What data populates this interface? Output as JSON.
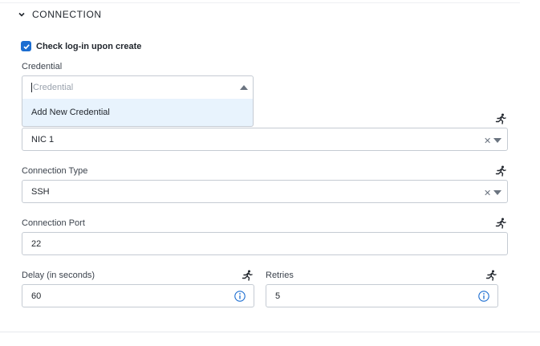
{
  "section": {
    "title": "CONNECTION"
  },
  "check_login": {
    "label": "Check log-in upon create",
    "checked": true
  },
  "credential": {
    "label": "Credential",
    "placeholder": "Credential",
    "options": [
      "Add New Credential"
    ]
  },
  "nic": {
    "value": "NIC 1"
  },
  "connection_type": {
    "label": "Connection Type",
    "value": "SSH"
  },
  "connection_port": {
    "label": "Connection Port",
    "value": "22"
  },
  "delay": {
    "label": "Delay (in seconds)",
    "value": "60"
  },
  "retries": {
    "label": "Retries",
    "value": "5"
  },
  "icons": {
    "section_toggle": "chevron-down-icon",
    "runtime": "running-person-icon",
    "info": "info-circle-icon",
    "clear": "clear-x-icon",
    "dropdown": "triangle-down-icon"
  },
  "colors": {
    "accent": "#1b6dd1",
    "menu_highlight": "#e8f3fd",
    "border": "#c5cbd3"
  }
}
